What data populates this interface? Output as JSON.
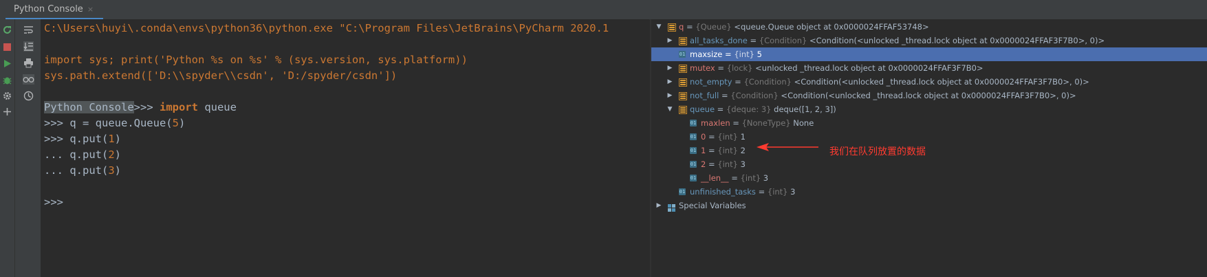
{
  "tab": {
    "title": "Python Console",
    "close": "×"
  },
  "left_toolbar": {
    "icons": [
      "rerun-icon",
      "stop-icon",
      "run-icon",
      "debug-icon",
      "settings-icon",
      "add-icon"
    ],
    "icons2": [
      "soft-wrap-icon",
      "scroll-to-end-icon",
      "print-icon",
      "show-variables-icon",
      "history-icon"
    ]
  },
  "console": {
    "lines": [
      "C:\\Users\\huyi\\.conda\\envs\\python36\\python.exe \"C:\\Program Files\\JetBrains\\PyCharm 2020.1",
      "",
      "import sys; print('Python %s on %s' % (sys.version, sys.platform))",
      "sys.path.extend(['D:\\\\spyder\\\\csdn', 'D:/spyder/csdn'])"
    ],
    "session": {
      "sel_label": "Python Console",
      "prompt1": ">>> ",
      "import_kw": "import",
      "import_mod": " queue",
      "line2_prompt": ">>> ",
      "line2_a": "q = queue.Queue(",
      "line2_num": "5",
      "line2_b": ")",
      "line3_prompt": ">>> ",
      "line3_a": "q.put(",
      "line3_num": "1",
      "line3_b": ")",
      "line4_prompt": "... ",
      "line4_a": "q.put(",
      "line4_num": "2",
      "line4_b": ")",
      "line5_prompt": "... ",
      "line5_a": "q.put(",
      "line5_num": "3",
      "line5_b": ")",
      "final_prompt": ">>>"
    }
  },
  "variables": {
    "rows": [
      {
        "arrow": "▼",
        "icon": "field",
        "name": "q",
        "eq": " = ",
        "type": "{Queue}",
        "value": " <queue.Queue object at 0x0000024FFAF53748>",
        "color": "red",
        "indent": 0
      },
      {
        "arrow": "▶",
        "icon": "field",
        "name": "all_tasks_done",
        "eq": " = ",
        "type": "{Condition}",
        "value": " <Condition(<unlocked _thread.lock object at 0x0000024FFAF3F7B0>, 0)>",
        "color": "blue",
        "indent": 1
      },
      {
        "arrow": "",
        "icon": "prim",
        "name": "maxsize",
        "eq": " = ",
        "type": "{int}",
        "value": " 5",
        "color": "blue",
        "indent": 1,
        "selected": true
      },
      {
        "arrow": "▶",
        "icon": "field",
        "name": "mutex",
        "eq": " = ",
        "type": "{lock}",
        "value": " <unlocked _thread.lock object at 0x0000024FFAF3F7B0>",
        "color": "red",
        "indent": 1
      },
      {
        "arrow": "▶",
        "icon": "field",
        "name": "not_empty",
        "eq": " = ",
        "type": "{Condition}",
        "value": " <Condition(<unlocked _thread.lock object at 0x0000024FFAF3F7B0>, 0)>",
        "color": "blue",
        "indent": 1
      },
      {
        "arrow": "▶",
        "icon": "field",
        "name": "not_full",
        "eq": " = ",
        "type": "{Condition}",
        "value": " <Condition(<unlocked _thread.lock object at 0x0000024FFAF3F7B0>, 0)>",
        "color": "blue",
        "indent": 1
      },
      {
        "arrow": "▼",
        "icon": "field",
        "name": "queue",
        "eq": " = ",
        "type": "{deque: 3}",
        "value": " deque([1, 2, 3])",
        "color": "blue",
        "indent": 1
      },
      {
        "arrow": "",
        "icon": "prim",
        "name": "maxlen",
        "eq": " = ",
        "type": "{NoneType}",
        "value": " None",
        "color": "red",
        "indent": 2
      },
      {
        "arrow": "",
        "icon": "prim",
        "name": "0",
        "eq": " = ",
        "type": "{int}",
        "value": " 1",
        "color": "red",
        "indent": 2
      },
      {
        "arrow": "",
        "icon": "prim",
        "name": "1",
        "eq": " = ",
        "type": "{int}",
        "value": " 2",
        "color": "red",
        "indent": 2
      },
      {
        "arrow": "",
        "icon": "prim",
        "name": "2",
        "eq": " = ",
        "type": "{int}",
        "value": " 3",
        "color": "red",
        "indent": 2
      },
      {
        "arrow": "",
        "icon": "prim",
        "name": "__len__",
        "eq": " = ",
        "type": "{int}",
        "value": " 3",
        "color": "red",
        "indent": 2
      },
      {
        "arrow": "",
        "icon": "prim",
        "name": "unfinished_tasks",
        "eq": " = ",
        "type": "{int}",
        "value": " 3",
        "color": "blue",
        "indent": 1
      },
      {
        "arrow": "▶",
        "icon": "grid",
        "name": "Special Variables",
        "eq": "",
        "type": "",
        "value": "",
        "color": "plain",
        "indent": 0
      }
    ]
  },
  "annotation": {
    "text": "我们在队列放置的数据",
    "color": "#ff3b30"
  }
}
